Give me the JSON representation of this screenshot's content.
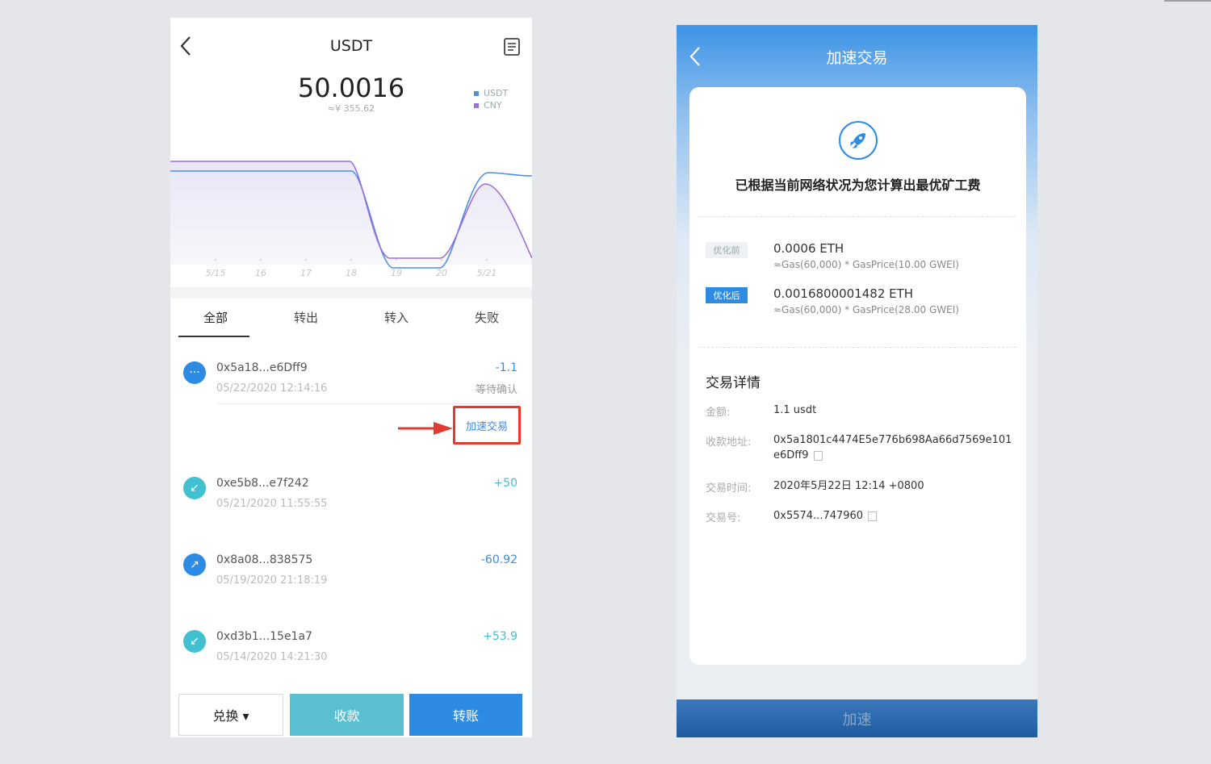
{
  "left": {
    "title": "USDT",
    "balance": "50.0016",
    "balance_cny": "≈¥ 355.62",
    "legend": [
      "USDT",
      "CNY"
    ],
    "tabs": [
      "全部",
      "转出",
      "转入",
      "失败"
    ],
    "transactions": [
      {
        "addr": "0x5a18...e6Dff9",
        "time": "05/22/2020 12:14:16",
        "amount": "-1.1",
        "status": "等待确认",
        "icon": "pending-icon",
        "icon_glyph": "···",
        "icon_color": "#2d8be4",
        "amount_color": "#3b8ce0"
      },
      {
        "addr": "0xe5b8...e7f242",
        "time": "05/21/2020 11:55:55",
        "amount": "+50",
        "status": "",
        "icon": "incoming-icon",
        "icon_glyph": "↙",
        "icon_color": "#41c0d1",
        "amount_color": "#41c0d1"
      },
      {
        "addr": "0x8a08...838575",
        "time": "05/19/2020 21:18:19",
        "amount": "-60.92",
        "status": "",
        "icon": "outgoing-icon",
        "icon_glyph": "↗",
        "icon_color": "#2d8be4",
        "amount_color": "#3b8ce0"
      },
      {
        "addr": "0xd3b1...15e1a7",
        "time": "05/14/2020 14:21:30",
        "amount": "+53.9",
        "status": "",
        "icon": "incoming-icon",
        "icon_glyph": "↙",
        "icon_color": "#41c0d1",
        "amount_color": "#41c0d1"
      }
    ],
    "speed_up_label": "加速交易",
    "buttons": {
      "exchange": "兑换 ▾",
      "receive": "收款",
      "transfer": "转账"
    }
  },
  "chart_data": {
    "type": "line",
    "categories": [
      "5/15",
      "16",
      "17",
      "18",
      "19",
      "20",
      "5/21"
    ],
    "series": [
      {
        "name": "USDT",
        "color": "#4a90e2",
        "values": [
          50,
          50,
          50,
          50,
          0,
          0,
          50
        ]
      },
      {
        "name": "CNY",
        "color": "#9b6fd6",
        "values": [
          355.62,
          355.62,
          355.62,
          355.62,
          0,
          0,
          355.62
        ]
      }
    ],
    "legend": "top-right",
    "grid": false
  },
  "right": {
    "title": "加速交易",
    "headline": "已根据当前网络状况为您计算出最优矿工费",
    "fees": [
      {
        "tag": "优化前",
        "main": "0.0006 ETH",
        "sub": "≈Gas(60,000) * GasPrice(10.00 GWEI)"
      },
      {
        "tag": "优化后",
        "main": "0.0016800001482 ETH",
        "sub": "≈Gas(60,000) * GasPrice(28.00 GWEI)"
      }
    ],
    "details_title": "交易详情",
    "details": [
      {
        "label": "金额:",
        "value": "1.1 usdt"
      },
      {
        "label": "收款地址:",
        "value": "0x5a1801c4474E5e776b698Aa66d7569e101e6Dff9"
      },
      {
        "label": "交易时间:",
        "value": "2020年5月22日 12:14 +0800"
      },
      {
        "label": "交易号:",
        "value": "0x5574...747960"
      }
    ],
    "speed_button": "加速"
  }
}
